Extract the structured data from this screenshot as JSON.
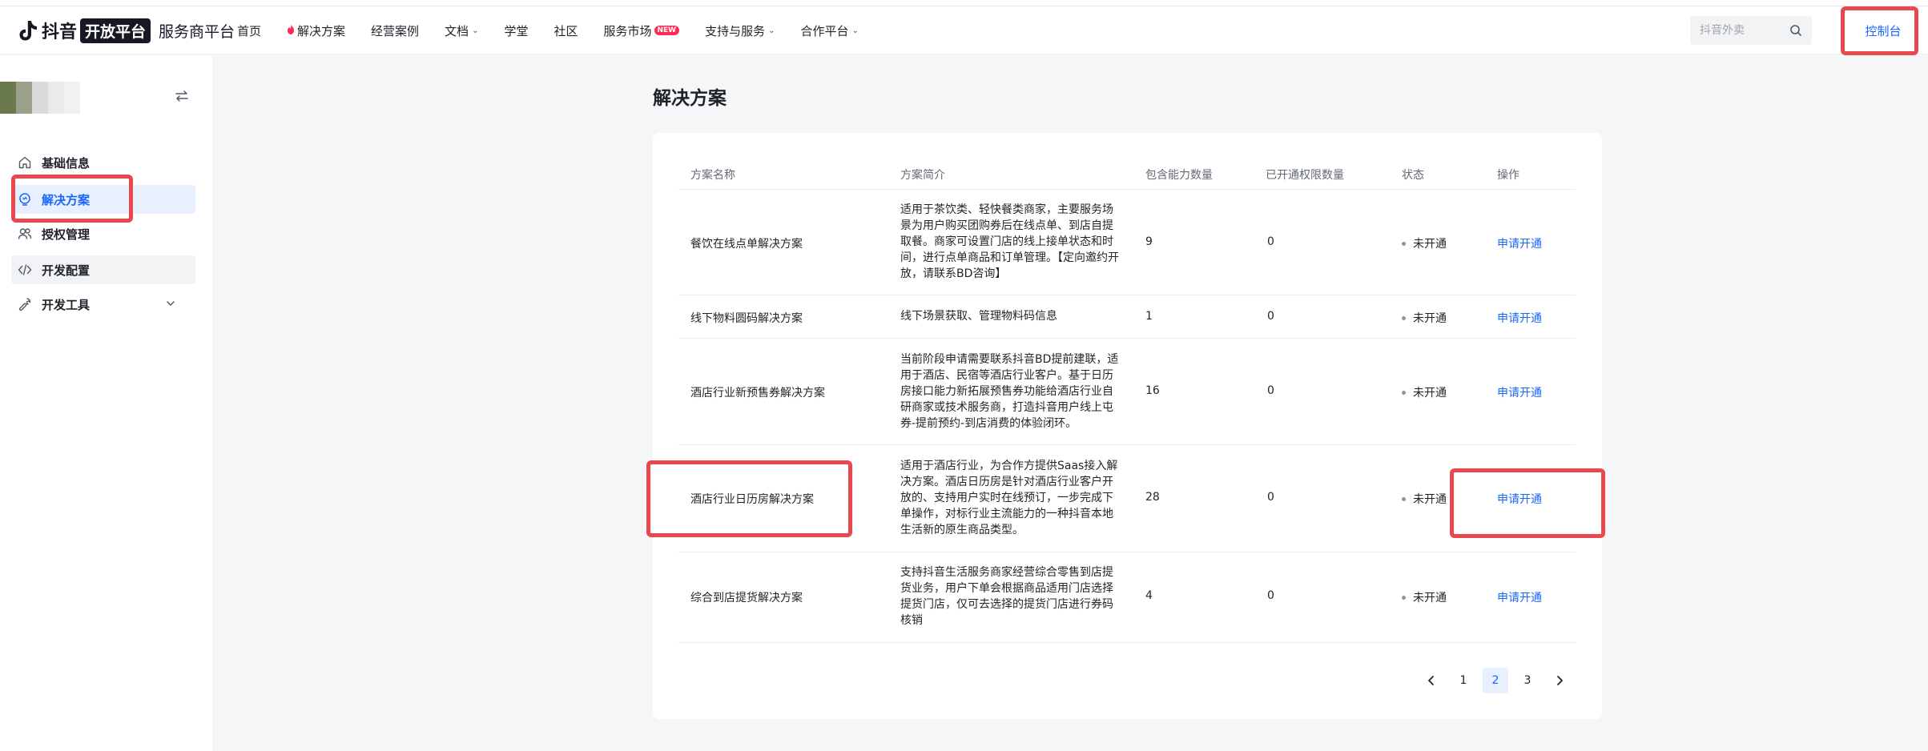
{
  "header": {
    "logo_text": "抖音",
    "logo_badge": "开放平台",
    "logo_sub": "服务商平台",
    "nav": [
      {
        "label": "首页"
      },
      {
        "label": "解决方案",
        "icon": "fire-icon"
      },
      {
        "label": "经营案例"
      },
      {
        "label": "文档",
        "dropdown": true
      },
      {
        "label": "学堂"
      },
      {
        "label": "社区"
      },
      {
        "label": "服务市场",
        "badge": "NEW"
      },
      {
        "label": "支持与服务",
        "dropdown": true
      },
      {
        "label": "合作平台",
        "dropdown": true
      }
    ],
    "search_placeholder": "抖音外卖",
    "console_label": "控制台"
  },
  "sidebar": {
    "items": [
      {
        "label": "基础信息",
        "icon": "home-icon"
      },
      {
        "label": "解决方案",
        "icon": "bulb-icon",
        "active": true
      },
      {
        "label": "授权管理",
        "icon": "users-icon"
      },
      {
        "label": "开发配置",
        "icon": "code-icon"
      },
      {
        "label": "开发工具",
        "icon": "wrench-icon",
        "expandable": true
      }
    ]
  },
  "main": {
    "title": "解决方案",
    "columns": [
      "方案名称",
      "方案简介",
      "包含能力数量",
      "已开通权限数量",
      "状态",
      "操作"
    ],
    "rows": [
      {
        "name": "餐饮在线点单解决方案",
        "desc": [
          "适用于茶饮类、轻快餐类商家，主要服务场",
          "景为用户购买团购券后在线点单、到店自提",
          "取餐。商家可设置门店的线上接单状态和时",
          "间，进行点单商品和订单管理。【定向邀约开",
          "放，请联系BD咨询】"
        ],
        "abilities": "9",
        "opened": "0",
        "status": "未开通",
        "action": "申请开通"
      },
      {
        "name": "线下物料圆码解决方案",
        "desc": [
          "线下场景获取、管理物料码信息"
        ],
        "abilities": "1",
        "opened": "0",
        "status": "未开通",
        "action": "申请开通"
      },
      {
        "name": "酒店行业新预售券解决方案",
        "desc": [
          "当前阶段申请需要联系抖音BD提前建联，适",
          "用于酒店、民宿等酒店行业客户。基于日历",
          "房接口能力新拓展预售券功能给酒店行业自",
          "研商家或技术服务商，打造抖音用户线上屯",
          "券-提前预约-到店消费的体验闭环。"
        ],
        "abilities": "16",
        "opened": "0",
        "status": "未开通",
        "action": "申请开通"
      },
      {
        "name": "酒店行业日历房解决方案",
        "desc": [
          "适用于酒店行业，为合作方提供Saas接入解",
          "决方案。酒店日历房是针对酒店行业客户开",
          "放的、支持用户实时在线预订，一步完成下",
          "单操作，对标行业主流能力的一种抖音本地",
          "生活新的原生商品类型。"
        ],
        "abilities": "28",
        "opened": "0",
        "status": "未开通",
        "action": "申请开通"
      },
      {
        "name": "综合到店提货解决方案",
        "desc": [
          "支持抖音生活服务商家经营综合零售到店提",
          "货业务，用户下单会根据商品适用门店选择",
          "提货门店，仅可去选择的提货门店进行券码",
          "核销"
        ],
        "abilities": "4",
        "opened": "0",
        "status": "未开通",
        "action": "申请开通"
      }
    ],
    "pagination": {
      "pages": [
        "1",
        "2",
        "3"
      ],
      "current": "2"
    }
  },
  "colors": {
    "accent": "#1966ff",
    "highlight": "#e9484f",
    "brand": "#fe2c55"
  }
}
